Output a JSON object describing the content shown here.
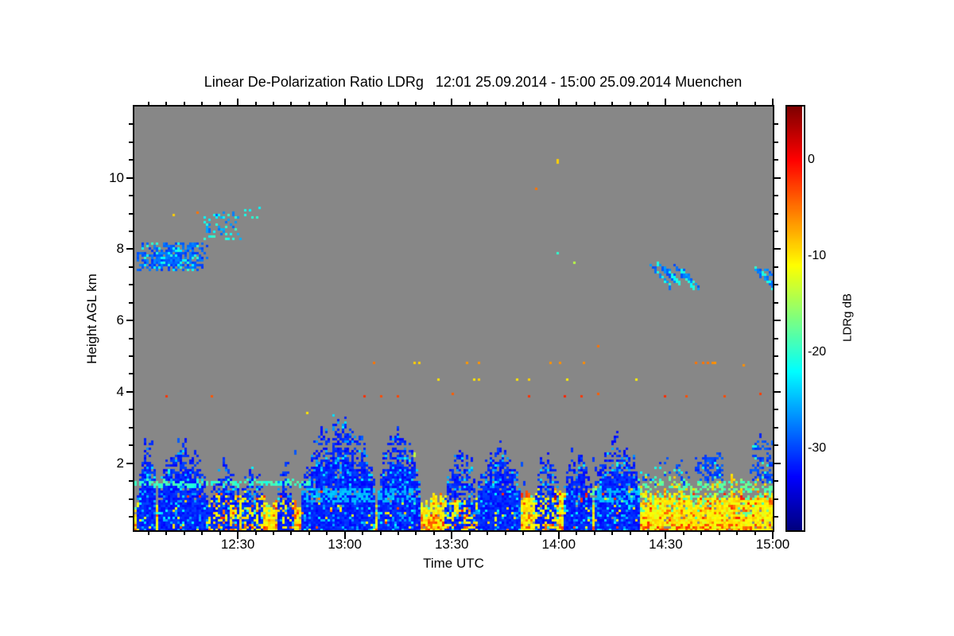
{
  "chart_data": {
    "type": "heatmap",
    "title": "Linear De-Polarization Ratio LDRg   12:01 25.09.2014 - 15:00 25.09.2014 Muenchen",
    "xlabel": "Time UTC",
    "ylabel": "Height AGL km",
    "no_data_color": "#878787",
    "frame_color": "#000000",
    "x_axis": {
      "start_minutes_after_12": 1,
      "end_minutes_after_12": 180,
      "major_ticks": [
        {
          "m": 30,
          "label": "12:30"
        },
        {
          "m": 60,
          "label": "13:00"
        },
        {
          "m": 90,
          "label": "13:30"
        },
        {
          "m": 120,
          "label": "14:00"
        },
        {
          "m": 150,
          "label": "14:30"
        },
        {
          "m": 180,
          "label": "15:00"
        }
      ],
      "minor_step_minutes": 5
    },
    "y_axis": {
      "min_km": 0.12,
      "max_km": 12.0,
      "major_ticks_km": [
        2,
        4,
        6,
        8,
        10
      ],
      "minor_step_km": 0.5
    },
    "colorbar": {
      "label": "LDRg dB",
      "min_db": -38.5,
      "max_db": 5.5,
      "major_ticks_db": [
        0,
        -10,
        -20,
        -30
      ],
      "minor_step_db": 1,
      "palette": "jet"
    },
    "features": {
      "surface_band": {
        "comment": "near-ground high-LDR (yellow/orange) aerosol-insect layer, top height km vs minutes",
        "top_km": [
          [
            1,
            0.85
          ],
          [
            8,
            0.7
          ],
          [
            16,
            0.8
          ],
          [
            24,
            1.0
          ],
          [
            32,
            1.05
          ],
          [
            40,
            0.85
          ],
          [
            48,
            0.8
          ],
          [
            56,
            0.9
          ],
          [
            64,
            0.85
          ],
          [
            72,
            0.8
          ],
          [
            80,
            0.85
          ],
          [
            88,
            1.0
          ],
          [
            96,
            0.9
          ],
          [
            104,
            1.0
          ],
          [
            112,
            1.1
          ],
          [
            119,
            1.15
          ],
          [
            126,
            0.8
          ],
          [
            133,
            0.85
          ],
          [
            140,
            0.9
          ],
          [
            145,
            1.05
          ],
          [
            152,
            1.1
          ],
          [
            158,
            0.95
          ],
          [
            164,
            1.1
          ],
          [
            170,
            1.05
          ],
          [
            176,
            1.1
          ],
          [
            180,
            1.15
          ]
        ],
        "value_db": -10.5
      },
      "green_zone": {
        "t0": 126,
        "t1": 180,
        "depth_km": 0.5,
        "value_db": -16
      },
      "plumes": {
        "comment": "low-LDR (deep blue ~ -31 dB) cloud plumes [t0,t1,top_km,solid,big]",
        "list": [
          [
            2,
            7,
            2.6,
            1,
            0
          ],
          [
            7.5,
            21.5,
            2.45,
            1,
            0
          ],
          [
            22,
            30.5,
            2.0,
            0,
            0
          ],
          [
            31,
            37,
            2.1,
            0,
            0
          ],
          [
            41,
            45.5,
            2.0,
            0,
            0
          ],
          [
            48,
            68.5,
            3.05,
            1,
            1
          ],
          [
            69.5,
            81,
            2.9,
            1,
            1
          ],
          [
            88,
            97,
            2.3,
            0,
            0
          ],
          [
            97,
            109.5,
            2.45,
            1,
            0
          ],
          [
            113.5,
            120,
            2.35,
            0,
            0
          ],
          [
            121.5,
            129.5,
            2.3,
            1,
            0
          ],
          [
            130,
            143,
            2.6,
            1,
            1
          ]
        ]
      },
      "cyan_line": {
        "segments_minutes": [
          [
            1,
            51
          ]
        ],
        "height_km": 1.45,
        "value_db": -19.5
      },
      "red_row": {
        "height_km": 1.08,
        "t_dense": [
          104,
          180
        ],
        "t_sparse": [
          8,
          104
        ],
        "value_db": -1.5,
        "darkred_fraction": 0.25
      },
      "speckle_band": {
        "h0_km": 1.35,
        "h1_km": 2.9,
        "density": 0.05,
        "value_db": -30.5
      },
      "mid_rows": [
        {
          "h_km": 3.9,
          "density": 0.045,
          "value_db": -3,
          "spread": 3,
          "t0": 8,
          "t1": 180
        },
        {
          "h_km": 4.35,
          "density": 0.05,
          "value_db": -9.5,
          "spread": 2,
          "t0": 55,
          "t1": 150
        },
        {
          "h_km": 4.8,
          "density": 0.028,
          "value_db": -6,
          "spread": 2,
          "t0": 40,
          "t1": 180
        }
      ],
      "mid_singles": {
        "h0_km": 2.95,
        "h1_km": 5.6,
        "density": 0.009,
        "values_db": [
          -9,
          -6,
          -3,
          -19,
          -14
        ]
      },
      "cloud_boxes": [
        [
          1.5,
          22,
          7.35,
          8.2,
          0.6,
          -29,
          4,
          0.18,
          1
        ],
        [
          20.5,
          31,
          8.3,
          9.05,
          0.28,
          -27,
          4,
          0.45,
          0
        ],
        [
          31.5,
          36.5,
          8.8,
          9.15,
          0.12,
          -24,
          3,
          0.5,
          0
        ],
        [
          143,
          158,
          1.4,
          2.2,
          0.1,
          -30,
          3,
          0.2,
          0
        ],
        [
          158,
          166.5,
          1.5,
          2.35,
          0.5,
          -30,
          3,
          0.08,
          1
        ],
        [
          174.5,
          180,
          1.45,
          2.6,
          0.4,
          -30,
          3,
          0.12,
          0
        ]
      ],
      "fall_streaks": [
        [
          146,
          7.55
        ],
        [
          148,
          7.6
        ],
        [
          150,
          7.5
        ],
        [
          152.5,
          7.55
        ],
        [
          154.5,
          7.45
        ],
        [
          175,
          7.5
        ],
        [
          176.5,
          7.4
        ],
        [
          178,
          7.45
        ]
      ],
      "dots": [
        [
          12,
          8.93,
          -9
        ],
        [
          18.6,
          9.0,
          -5
        ],
        [
          68.1,
          4.81,
          -5
        ],
        [
          79.5,
          4.81,
          -9
        ],
        [
          81,
          4.81,
          -9
        ],
        [
          113.8,
          9.67,
          -5
        ],
        [
          120,
          10.5,
          -9
        ],
        [
          120,
          10.43,
          -9
        ],
        [
          119.8,
          7.86,
          -20
        ],
        [
          124.7,
          7.62,
          -14
        ],
        [
          131.2,
          5.3,
          -5
        ],
        [
          158.8,
          4.79,
          -5
        ],
        [
          160.2,
          4.79,
          -5
        ],
        [
          161.7,
          4.79,
          -5
        ],
        [
          163,
          4.79,
          -6
        ]
      ]
    }
  }
}
